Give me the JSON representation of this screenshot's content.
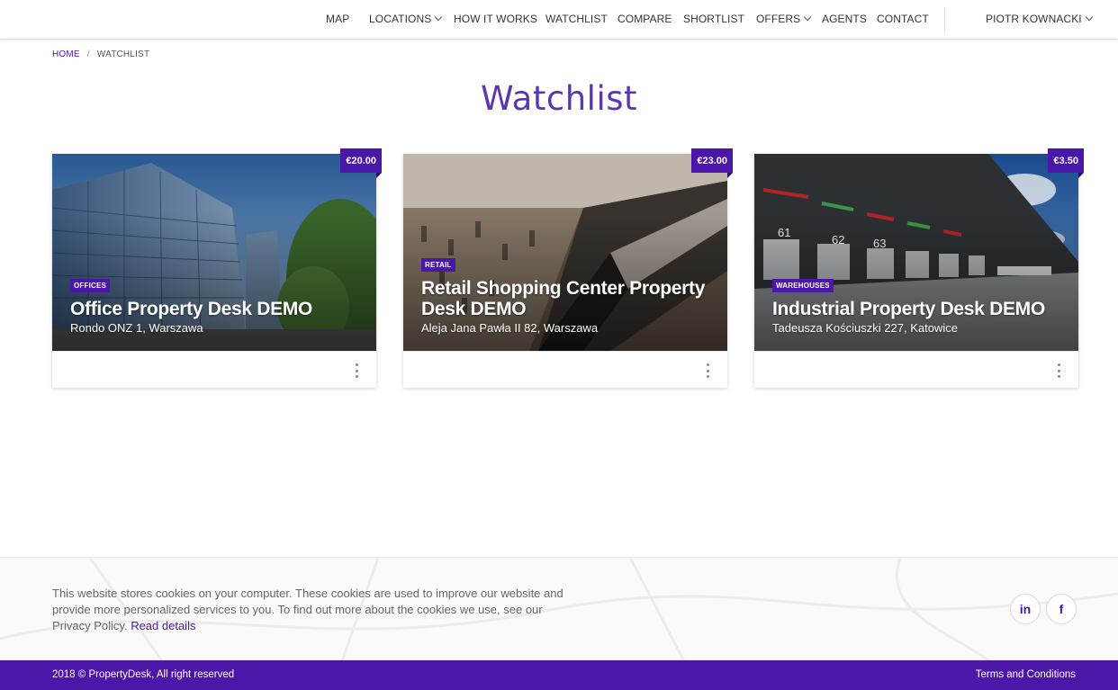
{
  "nav": {
    "items": [
      {
        "label": "MAP"
      },
      {
        "label": "LOCATIONS"
      },
      {
        "label": "HOW IT WORKS"
      },
      {
        "label": "WATCHLIST"
      },
      {
        "label": "COMPARE"
      },
      {
        "label": "SHORTLIST"
      },
      {
        "label": "OFFERS"
      },
      {
        "label": "AGENTS"
      },
      {
        "label": "CONTACT"
      }
    ],
    "user": "PIOTR KOWNACKI"
  },
  "breadcrumb": {
    "home": "HOME",
    "separator": "/",
    "current": "WATCHLIST"
  },
  "page_title": "Watchlist",
  "cards": [
    {
      "price": "€20.00",
      "tag": "OFFICES",
      "title": "Office Property Desk DEMO",
      "address": "Rondo ONZ 1, Warszawa"
    },
    {
      "price": "€23.00",
      "tag": "RETAIL",
      "title": "Retail Shopping Center Property Desk DEMO",
      "address": "Aleja Jana Pawła II 82, Warszawa"
    },
    {
      "price": "€3.50",
      "tag": "WAREHOUSES",
      "title": "Industrial Property Desk DEMO",
      "address": "Tadeusza Kościuszki 227, Katowice"
    }
  ],
  "footer": {
    "cookie_text": "This website stores cookies on your computer. These cookies are used to improve our website and provide more personalized services to you. To find out more about the cookies we use, see our Privacy Policy.",
    "cookie_link": "Read details",
    "linkedin": "in",
    "facebook": "f",
    "copyright": "2018 © PropertyDesk, All right reserved",
    "terms": "Terms and Conditions"
  },
  "colors": {
    "accent": "#4a17a8",
    "title": "#5e35b1"
  }
}
